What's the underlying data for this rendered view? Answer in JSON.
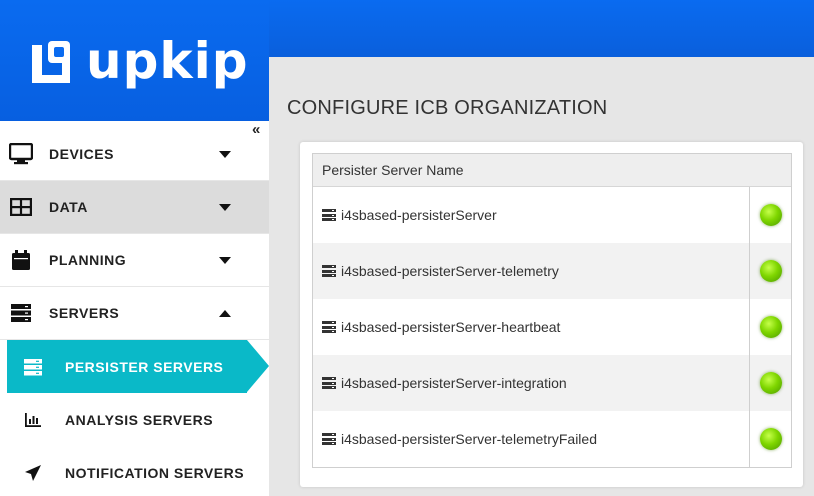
{
  "brand": {
    "name": "upkip"
  },
  "sidebar": {
    "collapse_label": "«",
    "items": [
      {
        "label": "DEVICES",
        "icon": "monitor-icon"
      },
      {
        "label": "DATA",
        "icon": "table-icon"
      },
      {
        "label": "PLANNING",
        "icon": "calendar-icon"
      },
      {
        "label": "SERVERS",
        "icon": "server-icon"
      }
    ],
    "sub_items": [
      {
        "label": "PERSISTER SERVERS",
        "icon": "server-stack-icon"
      },
      {
        "label": "ANALYSIS SERVERS",
        "icon": "bar-chart-icon"
      },
      {
        "label": "NOTIFICATION SERVERS",
        "icon": "send-icon"
      }
    ]
  },
  "main": {
    "title": "CONFIGURE ICB ORGANIZATION",
    "table": {
      "header": "Persister Server Name",
      "rows": [
        {
          "name": "i4sbased-persisterServer",
          "status": "online"
        },
        {
          "name": "i4sbased-persisterServer-telemetry",
          "status": "online"
        },
        {
          "name": "i4sbased-persisterServer-heartbeat",
          "status": "online"
        },
        {
          "name": "i4sbased-persisterServer-integration",
          "status": "online"
        },
        {
          "name": "i4sbased-persisterServer-telemetryFailed",
          "status": "online"
        }
      ]
    }
  },
  "colors": {
    "brand_blue": "#0a6bf0",
    "active_teal": "#0ab9c8",
    "status_green": "#7fd600"
  }
}
